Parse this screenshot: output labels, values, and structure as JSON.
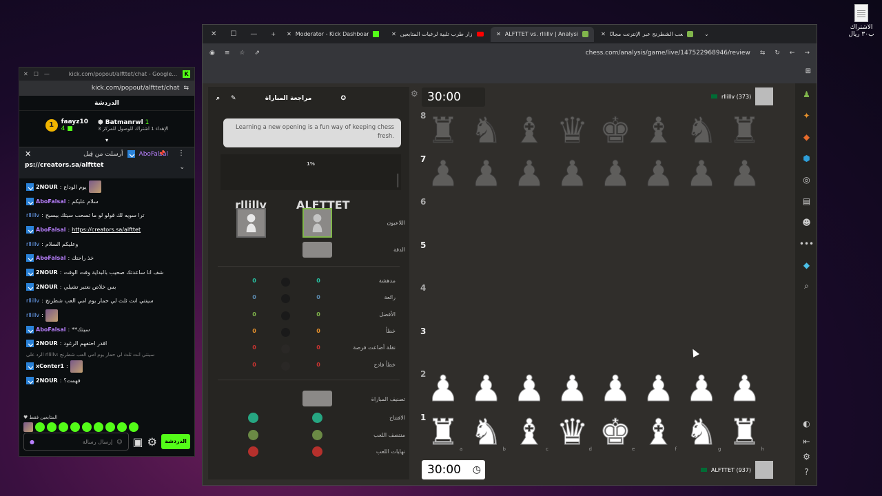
{
  "desktop": {
    "file_label": "الاشتراك ب٣٠ ريال"
  },
  "popout": {
    "title": "kick.com/popout/alfttet/chat - Google...",
    "url": "kick.com/popout/alfttet/chat",
    "chat_title": "الدردشة",
    "leaders": [
      {
        "name": "faayz10",
        "rank": "1",
        "count": "4",
        "sub": ""
      },
      {
        "name": "Batmanrwl",
        "rank": "",
        "count": "1",
        "sub": "الإهداء 1 اشتراك للوصول للمركز 3"
      }
    ],
    "pinned": {
      "user": "AboFalsal",
      "prefix": "أرسلت من قِبل",
      "link": "ps://creators.sa/alfttet"
    },
    "messages": [
      {
        "user": "2NOUR",
        "cls": "u-white",
        "text": "يوم الوداع",
        "emote": true
      },
      {
        "user": "AboFalsal",
        "cls": "u-purple",
        "text": "سلام عليكم",
        "emote": false
      },
      {
        "user": "rllillv",
        "cls": "u-blue",
        "text": "ترا سويه لك قولو لو ما تسحب سيتك بيسيح",
        "emote": false,
        "nobadge": true
      },
      {
        "user": "AboFalsal",
        "cls": "u-purple",
        "text": "https://creators.sa/alfttet",
        "emote": false,
        "link": true
      },
      {
        "user": "rllillv",
        "cls": "u-blue",
        "text": "وعليكم السلام",
        "emote": false,
        "nobadge": true
      },
      {
        "user": "AboFalsal",
        "cls": "u-purple",
        "text": "خذ راحتك",
        "emote": false
      },
      {
        "user": "2NOUR",
        "cls": "u-white",
        "text": "شف انا ساعدتك صحيب بالبداية وقت الوقت",
        "emote": false
      },
      {
        "user": "2NOUR",
        "cls": "u-white",
        "text": "بس خلاص نعتبر تشيلي",
        "emote": false
      },
      {
        "user": "rllillv",
        "cls": "u-blue",
        "text": "سينتي انت ثلث لي حمار يوم امي العب شطرنج",
        "emote": false,
        "nobadge": true
      },
      {
        "user": "rllillv",
        "cls": "u-blue",
        "text": "",
        "emote": true,
        "nobadge": true
      },
      {
        "user": "AboFalsal",
        "cls": "u-purple",
        "text": "**سيتك",
        "emote": false
      },
      {
        "user": "2NOUR",
        "cls": "u-white",
        "text": "اقدر احتفهم الرغود",
        "emote": false
      }
    ],
    "reply_hint": "الرد على rllillv: سينتي انت ثلث لي حمار يوم امي العب شطرنج",
    "messages2": [
      {
        "user": "xConter1",
        "cls": "u-white",
        "text": "",
        "emote": true
      },
      {
        "user": "2NOUR",
        "cls": "u-white",
        "text": "فهمت؟",
        "emote": false
      }
    ],
    "emote_label": "المتابعين فقط",
    "input_placeholder": "إرسال رسالة",
    "send_label": "الدردشة"
  },
  "browser": {
    "tabs": [
      {
        "label": "العب الشطرنج عبر الإنترنت مجانًا",
        "icon": "chess",
        "active": false
      },
      {
        "label": "ALFTTET vs. rllillv | Analysis - Chess.com",
        "icon": "chess",
        "active": true
      },
      {
        "label": "زار طرب تلبية لرغبات المتابعين",
        "icon": "yt",
        "active": false
      },
      {
        "label": "Moderator - Kick Dashboard",
        "icon": "kick",
        "active": false
      }
    ],
    "url": "chess.com/analysis/game/live/147522968946/review"
  },
  "review": {
    "title": "مراجعة المباراة",
    "coach_text": "Learning a new opening is a fun way of keeping chess fresh.",
    "eval_pct": "1%",
    "player_left": "rllillv",
    "player_right": "ALFTTET",
    "players_label": "اللاعبون",
    "accuracy_label": "الدقة",
    "stats": [
      {
        "label": "مدهشة",
        "left": "0",
        "right": "0",
        "color": "#26c2a3",
        "dot": "#1a1a1a"
      },
      {
        "label": "رائعة",
        "left": "0",
        "right": "0",
        "color": "#5c8bb0",
        "dot": "#1a1a1a"
      },
      {
        "label": "الأفضل",
        "left": "0",
        "right": "0",
        "color": "#81b64c",
        "dot": "#1a1a1a"
      },
      {
        "label": "خطأ",
        "left": "0",
        "right": "0",
        "color": "#e6912c",
        "dot": "#1a1a1a"
      },
      {
        "label": "نقلة أضاعت فرصة",
        "left": "0",
        "right": "0",
        "color": "#ca3431",
        "dot": "#2a2826"
      },
      {
        "label": "خطأ فادح",
        "left": "0",
        "right": "0",
        "color": "#ca3431",
        "dot": "#2a2826"
      }
    ],
    "rating_label": "تصنيف المباراة",
    "phases": [
      {
        "label": "الافتتاح",
        "left": "#26a682",
        "right": "#26a682"
      },
      {
        "label": "منتصف اللعب",
        "left": "#6b8a45",
        "right": "#6b8a45"
      },
      {
        "label": "نهايات اللعب",
        "left": "#b5302c",
        "right": "#b5302c"
      }
    ]
  },
  "board": {
    "top_player": "rllillv (373)",
    "bottom_player": "ALFTTET (937)",
    "top_clock": "30:00",
    "bottom_clock": "30:00",
    "ranks": [
      "8",
      "7",
      "6",
      "5",
      "4",
      "3",
      "2",
      "1"
    ],
    "back_rank": [
      "♜",
      "♞",
      "♝",
      "♛",
      "♚",
      "♝",
      "♞",
      "♜"
    ],
    "pawn": "♟",
    "files": [
      "a",
      "b",
      "c",
      "d",
      "e",
      "f",
      "g",
      "h"
    ]
  }
}
